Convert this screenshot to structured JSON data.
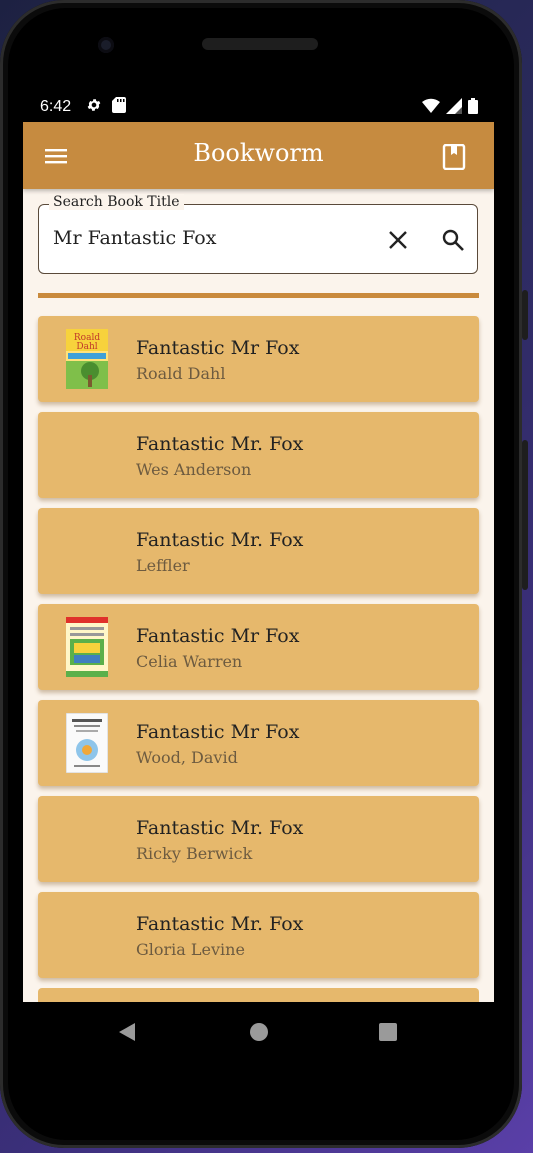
{
  "status_bar": {
    "time": "6:42",
    "left_icons": [
      "gear-icon",
      "sd-card-icon"
    ],
    "right_icons": [
      "wifi-icon",
      "signal-icon",
      "battery-icon"
    ]
  },
  "app_bar": {
    "title": "Bookworm",
    "menu_icon": "menu-icon",
    "action_icon": "book-icon"
  },
  "search": {
    "label": "Search Book Title",
    "value": "Mr Fantastic Fox",
    "clear_icon": "close-icon",
    "search_icon": "search-icon"
  },
  "results": [
    {
      "title": "Fantastic Mr Fox",
      "author": "Roald Dahl",
      "cover": "cover-roald-dahl"
    },
    {
      "title": "Fantastic Mr. Fox",
      "author": "Wes Anderson",
      "cover": ""
    },
    {
      "title": "Fantastic Mr. Fox",
      "author": "Leffler",
      "cover": ""
    },
    {
      "title": "Fantastic Mr Fox",
      "author": "Celia Warren",
      "cover": "cover-celia-warren"
    },
    {
      "title": "Fantastic Mr Fox",
      "author": "Wood, David",
      "cover": "cover-wood-david"
    },
    {
      "title": "Fantastic Mr. Fox",
      "author": "Ricky Berwick",
      "cover": ""
    },
    {
      "title": "Fantastic Mr. Fox",
      "author": "Gloria Levine",
      "cover": ""
    }
  ],
  "colors": {
    "app_bar": "#c68b40",
    "card": "#e6b86c",
    "divider": "#c98a3d",
    "background": "#fbf4ec"
  },
  "nav_bar": [
    "back-icon",
    "home-icon",
    "recents-icon"
  ]
}
